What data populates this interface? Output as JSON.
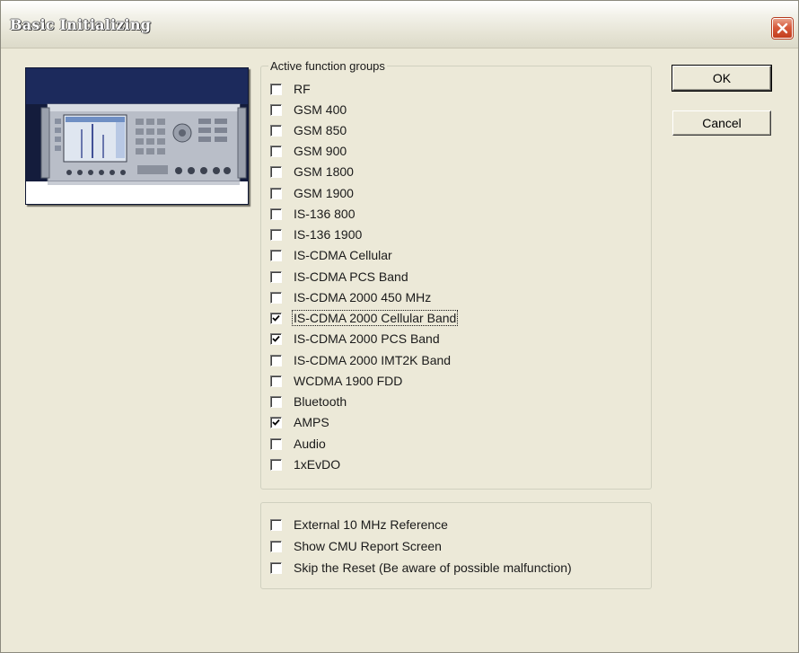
{
  "window": {
    "title": "Basic Initializing",
    "close_icon": "close-icon"
  },
  "device_image": {
    "icon": "device-picture",
    "colors": {
      "background": "#141c3c",
      "panel": "#c8ccd4",
      "screen": "#e8eef6"
    }
  },
  "active_groups": {
    "legend": "Active function groups",
    "items": [
      {
        "label": "RF",
        "checked": false
      },
      {
        "label": "GSM 400",
        "checked": false
      },
      {
        "label": "GSM 850",
        "checked": false
      },
      {
        "label": "GSM 900",
        "checked": false
      },
      {
        "label": "GSM 1800",
        "checked": false
      },
      {
        "label": "GSM 1900",
        "checked": false
      },
      {
        "label": "IS-136 800",
        "checked": false
      },
      {
        "label": "IS-136 1900",
        "checked": false
      },
      {
        "label": "IS-CDMA Cellular",
        "checked": false
      },
      {
        "label": "IS-CDMA PCS Band",
        "checked": false
      },
      {
        "label": "IS-CDMA 2000 450 MHz",
        "checked": false
      },
      {
        "label": "IS-CDMA 2000 Cellular Band",
        "checked": true,
        "focused": true
      },
      {
        "label": "IS-CDMA 2000 PCS Band",
        "checked": true
      },
      {
        "label": "IS-CDMA 2000 IMT2K Band",
        "checked": false
      },
      {
        "label": "WCDMA 1900 FDD",
        "checked": false
      },
      {
        "label": "Bluetooth",
        "checked": false
      },
      {
        "label": "AMPS",
        "checked": true
      },
      {
        "label": "Audio",
        "checked": false
      },
      {
        "label": "1xEvDO",
        "checked": false
      }
    ]
  },
  "options": {
    "items": [
      {
        "label": "External 10 MHz Reference",
        "checked": false
      },
      {
        "label": "Show CMU Report Screen",
        "checked": false
      },
      {
        "label": "Skip the Reset (Be aware of possible malfunction)",
        "checked": false
      }
    ]
  },
  "buttons": {
    "ok": "OK",
    "cancel": "Cancel"
  }
}
